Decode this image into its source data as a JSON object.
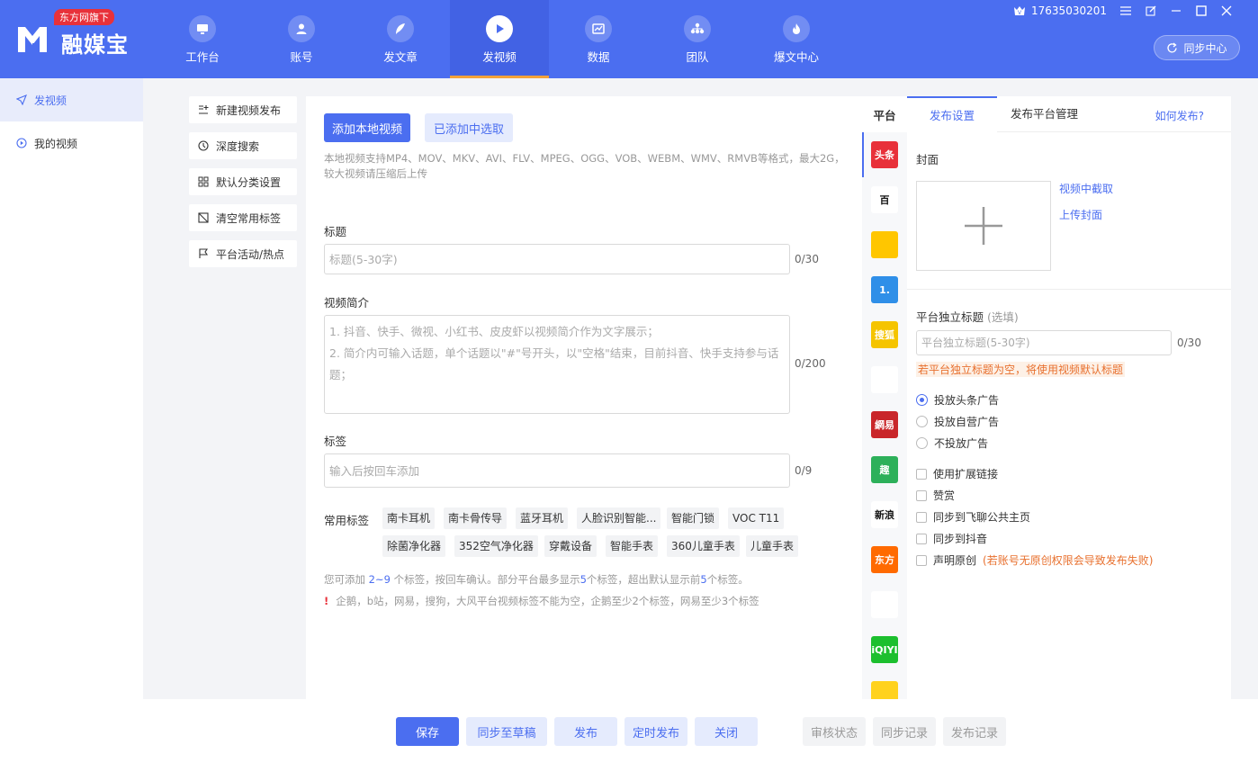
{
  "header": {
    "badge": "东方网旗下",
    "brand": "融媒宝",
    "phone": "17635030201",
    "sync_center": "同步中心",
    "colors": {
      "primary": "#4b6ef0",
      "accent": "#f2a23a"
    },
    "nav": [
      {
        "label": "工作台",
        "icon": "monitor-icon"
      },
      {
        "label": "账号",
        "icon": "user-icon"
      },
      {
        "label": "发文章",
        "icon": "feather-icon"
      },
      {
        "label": "发视频",
        "icon": "play-icon"
      },
      {
        "label": "数据",
        "icon": "chart-icon"
      },
      {
        "label": "团队",
        "icon": "team-icon"
      },
      {
        "label": "爆文中心",
        "icon": "flame-icon"
      }
    ]
  },
  "sidebar": {
    "items": [
      {
        "label": "发视频",
        "icon": "send-icon"
      },
      {
        "label": "我的视频",
        "icon": "play-circle-icon"
      }
    ]
  },
  "tools": {
    "items": [
      {
        "label": "新建视频发布",
        "icon": "new-list-icon"
      },
      {
        "label": "深度搜索",
        "icon": "search-clock-icon"
      },
      {
        "label": "默认分类设置",
        "icon": "grid-icon"
      },
      {
        "label": "清空常用标签",
        "icon": "tag-clear-icon"
      },
      {
        "label": "平台活动/热点",
        "icon": "flag-icon"
      }
    ]
  },
  "form": {
    "add_local": "添加本地视频",
    "pick_added": "已添加中选取",
    "format_tip": "本地视频支持MP4、MOV、MKV、AVI、FLV、MPEG、OGG、VOB、WEBM、WMV、RMVB等格式，最大2G，较大视频请压缩后上传",
    "title_label": "标题",
    "title_placeholder": "标题(5-30字)",
    "title_count": "0/30",
    "desc_label": "视频简介",
    "desc_placeholder": "1. 抖音、快手、微视、小红书、皮皮虾以视频简介作为文字展示；\n2. 简介内可输入话题，单个话题以\"#\"号开头，以\"空格\"结束，目前抖音、快手支持参与话题；",
    "desc_count": "0/200",
    "tags_label": "标签",
    "tags_placeholder": "输入后按回车添加",
    "tags_count": "0/9",
    "common_tags_label": "常用标签",
    "common_tags": [
      "南卡耳机",
      "南卡骨传导",
      "蓝牙耳机",
      "人脸识别智能...",
      "智能门锁",
      "VOC T11",
      "除菌净化器",
      "352空气净化器",
      "穿戴设备",
      "智能手表",
      "360儿童手表",
      "儿童手表"
    ],
    "hint1_a": "您可添加 ",
    "hint1_range": "2~9",
    "hint1_b": " 个标签，按回车确认。部分平台最多显示",
    "hint1_n1": "5",
    "hint1_c": "个标签，超出默认显示前",
    "hint1_n2": "5",
    "hint1_d": "个标签。",
    "hint2_icon": "!",
    "hint2": "企鹅，b站，网易，搜狗，大风平台视频标签不能为空，企鹅至少2个标签，网易至少3个标签"
  },
  "platforms": {
    "title": "平台",
    "items": [
      {
        "name": "toutiao",
        "text": "头条",
        "color": "#e8313a"
      },
      {
        "name": "baijia",
        "text": "百",
        "color": "#ffffff"
      },
      {
        "name": "qq",
        "text": "",
        "color": "#ffc600"
      },
      {
        "name": "yidian",
        "text": "1.",
        "color": "#2f8fe8"
      },
      {
        "name": "sohu",
        "text": "搜狐",
        "color": "#f5c400"
      },
      {
        "name": "weibo",
        "text": "",
        "color": "#ffffff"
      },
      {
        "name": "netease",
        "text": "網易",
        "color": "#c9262a"
      },
      {
        "name": "qutoutiao",
        "text": "趣",
        "color": "#2db05a"
      },
      {
        "name": "xinlang8",
        "text": "新浪",
        "color": "#ffffff"
      },
      {
        "name": "dongfang",
        "text": "东方",
        "color": "#ff6a00"
      },
      {
        "name": "fenghuang",
        "text": "",
        "color": "#ffffff"
      },
      {
        "name": "iqiyi",
        "text": "iQIYI",
        "color": "#1cbf2e"
      },
      {
        "name": "other",
        "text": "",
        "color": "#ffd21e"
      }
    ]
  },
  "settings": {
    "tab_publish": "发布设置",
    "tab_manage": "发布平台管理",
    "how_link": "如何发布?",
    "cover_label": "封面",
    "cover_from_video": "视频中截取",
    "cover_upload": "上传封面",
    "indep_title_label": "平台独立标题",
    "indep_title_opt": "(选填)",
    "indep_placeholder": "平台独立标题(5-30字)",
    "indep_count": "0/30",
    "indep_warn": "若平台独立标题为空，将使用视频默认标题",
    "ad_options": [
      "投放头条广告",
      "投放自营广告",
      "不投放广告"
    ],
    "check_options": [
      "使用扩展链接",
      "赞赏",
      "同步到飞聊公共主页",
      "同步到抖音",
      "声明原创"
    ],
    "original_note": "(若账号无原创权限会导致发布失败)"
  },
  "bottom": {
    "save": "保存",
    "sync_draft": "同步至草稿",
    "publish": "发布",
    "schedule": "定时发布",
    "close": "关闭",
    "review": "审核状态",
    "sync_log": "同步记录",
    "publish_log": "发布记录"
  }
}
